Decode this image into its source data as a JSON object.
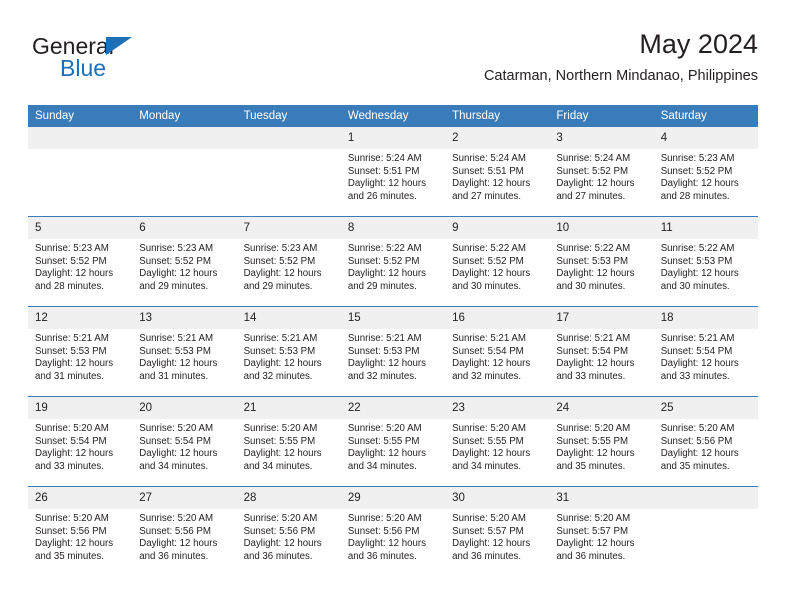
{
  "brand": {
    "name_top": "General",
    "name_bottom": "Blue",
    "accent_color": "#1d6fb8"
  },
  "header": {
    "month_title": "May 2024",
    "location": "Catarman, Northern Mindanao, Philippines"
  },
  "calendar": {
    "header_bg": "#3a7cba",
    "daynum_bg": "#f0f0f0",
    "weekdays": [
      "Sunday",
      "Monday",
      "Tuesday",
      "Wednesday",
      "Thursday",
      "Friday",
      "Saturday"
    ],
    "weeks": [
      [
        {
          "day": "",
          "lines": []
        },
        {
          "day": "",
          "lines": []
        },
        {
          "day": "",
          "lines": []
        },
        {
          "day": "1",
          "lines": [
            "Sunrise: 5:24 AM",
            "Sunset: 5:51 PM",
            "Daylight: 12 hours",
            "and 26 minutes."
          ]
        },
        {
          "day": "2",
          "lines": [
            "Sunrise: 5:24 AM",
            "Sunset: 5:51 PM",
            "Daylight: 12 hours",
            "and 27 minutes."
          ]
        },
        {
          "day": "3",
          "lines": [
            "Sunrise: 5:24 AM",
            "Sunset: 5:52 PM",
            "Daylight: 12 hours",
            "and 27 minutes."
          ]
        },
        {
          "day": "4",
          "lines": [
            "Sunrise: 5:23 AM",
            "Sunset: 5:52 PM",
            "Daylight: 12 hours",
            "and 28 minutes."
          ]
        }
      ],
      [
        {
          "day": "5",
          "lines": [
            "Sunrise: 5:23 AM",
            "Sunset: 5:52 PM",
            "Daylight: 12 hours",
            "and 28 minutes."
          ]
        },
        {
          "day": "6",
          "lines": [
            "Sunrise: 5:23 AM",
            "Sunset: 5:52 PM",
            "Daylight: 12 hours",
            "and 29 minutes."
          ]
        },
        {
          "day": "7",
          "lines": [
            "Sunrise: 5:23 AM",
            "Sunset: 5:52 PM",
            "Daylight: 12 hours",
            "and 29 minutes."
          ]
        },
        {
          "day": "8",
          "lines": [
            "Sunrise: 5:22 AM",
            "Sunset: 5:52 PM",
            "Daylight: 12 hours",
            "and 29 minutes."
          ]
        },
        {
          "day": "9",
          "lines": [
            "Sunrise: 5:22 AM",
            "Sunset: 5:52 PM",
            "Daylight: 12 hours",
            "and 30 minutes."
          ]
        },
        {
          "day": "10",
          "lines": [
            "Sunrise: 5:22 AM",
            "Sunset: 5:53 PM",
            "Daylight: 12 hours",
            "and 30 minutes."
          ]
        },
        {
          "day": "11",
          "lines": [
            "Sunrise: 5:22 AM",
            "Sunset: 5:53 PM",
            "Daylight: 12 hours",
            "and 30 minutes."
          ]
        }
      ],
      [
        {
          "day": "12",
          "lines": [
            "Sunrise: 5:21 AM",
            "Sunset: 5:53 PM",
            "Daylight: 12 hours",
            "and 31 minutes."
          ]
        },
        {
          "day": "13",
          "lines": [
            "Sunrise: 5:21 AM",
            "Sunset: 5:53 PM",
            "Daylight: 12 hours",
            "and 31 minutes."
          ]
        },
        {
          "day": "14",
          "lines": [
            "Sunrise: 5:21 AM",
            "Sunset: 5:53 PM",
            "Daylight: 12 hours",
            "and 32 minutes."
          ]
        },
        {
          "day": "15",
          "lines": [
            "Sunrise: 5:21 AM",
            "Sunset: 5:53 PM",
            "Daylight: 12 hours",
            "and 32 minutes."
          ]
        },
        {
          "day": "16",
          "lines": [
            "Sunrise: 5:21 AM",
            "Sunset: 5:54 PM",
            "Daylight: 12 hours",
            "and 32 minutes."
          ]
        },
        {
          "day": "17",
          "lines": [
            "Sunrise: 5:21 AM",
            "Sunset: 5:54 PM",
            "Daylight: 12 hours",
            "and 33 minutes."
          ]
        },
        {
          "day": "18",
          "lines": [
            "Sunrise: 5:21 AM",
            "Sunset: 5:54 PM",
            "Daylight: 12 hours",
            "and 33 minutes."
          ]
        }
      ],
      [
        {
          "day": "19",
          "lines": [
            "Sunrise: 5:20 AM",
            "Sunset: 5:54 PM",
            "Daylight: 12 hours",
            "and 33 minutes."
          ]
        },
        {
          "day": "20",
          "lines": [
            "Sunrise: 5:20 AM",
            "Sunset: 5:54 PM",
            "Daylight: 12 hours",
            "and 34 minutes."
          ]
        },
        {
          "day": "21",
          "lines": [
            "Sunrise: 5:20 AM",
            "Sunset: 5:55 PM",
            "Daylight: 12 hours",
            "and 34 minutes."
          ]
        },
        {
          "day": "22",
          "lines": [
            "Sunrise: 5:20 AM",
            "Sunset: 5:55 PM",
            "Daylight: 12 hours",
            "and 34 minutes."
          ]
        },
        {
          "day": "23",
          "lines": [
            "Sunrise: 5:20 AM",
            "Sunset: 5:55 PM",
            "Daylight: 12 hours",
            "and 34 minutes."
          ]
        },
        {
          "day": "24",
          "lines": [
            "Sunrise: 5:20 AM",
            "Sunset: 5:55 PM",
            "Daylight: 12 hours",
            "and 35 minutes."
          ]
        },
        {
          "day": "25",
          "lines": [
            "Sunrise: 5:20 AM",
            "Sunset: 5:56 PM",
            "Daylight: 12 hours",
            "and 35 minutes."
          ]
        }
      ],
      [
        {
          "day": "26",
          "lines": [
            "Sunrise: 5:20 AM",
            "Sunset: 5:56 PM",
            "Daylight: 12 hours",
            "and 35 minutes."
          ]
        },
        {
          "day": "27",
          "lines": [
            "Sunrise: 5:20 AM",
            "Sunset: 5:56 PM",
            "Daylight: 12 hours",
            "and 36 minutes."
          ]
        },
        {
          "day": "28",
          "lines": [
            "Sunrise: 5:20 AM",
            "Sunset: 5:56 PM",
            "Daylight: 12 hours",
            "and 36 minutes."
          ]
        },
        {
          "day": "29",
          "lines": [
            "Sunrise: 5:20 AM",
            "Sunset: 5:56 PM",
            "Daylight: 12 hours",
            "and 36 minutes."
          ]
        },
        {
          "day": "30",
          "lines": [
            "Sunrise: 5:20 AM",
            "Sunset: 5:57 PM",
            "Daylight: 12 hours",
            "and 36 minutes."
          ]
        },
        {
          "day": "31",
          "lines": [
            "Sunrise: 5:20 AM",
            "Sunset: 5:57 PM",
            "Daylight: 12 hours",
            "and 36 minutes."
          ]
        },
        {
          "day": "",
          "lines": []
        }
      ]
    ]
  }
}
